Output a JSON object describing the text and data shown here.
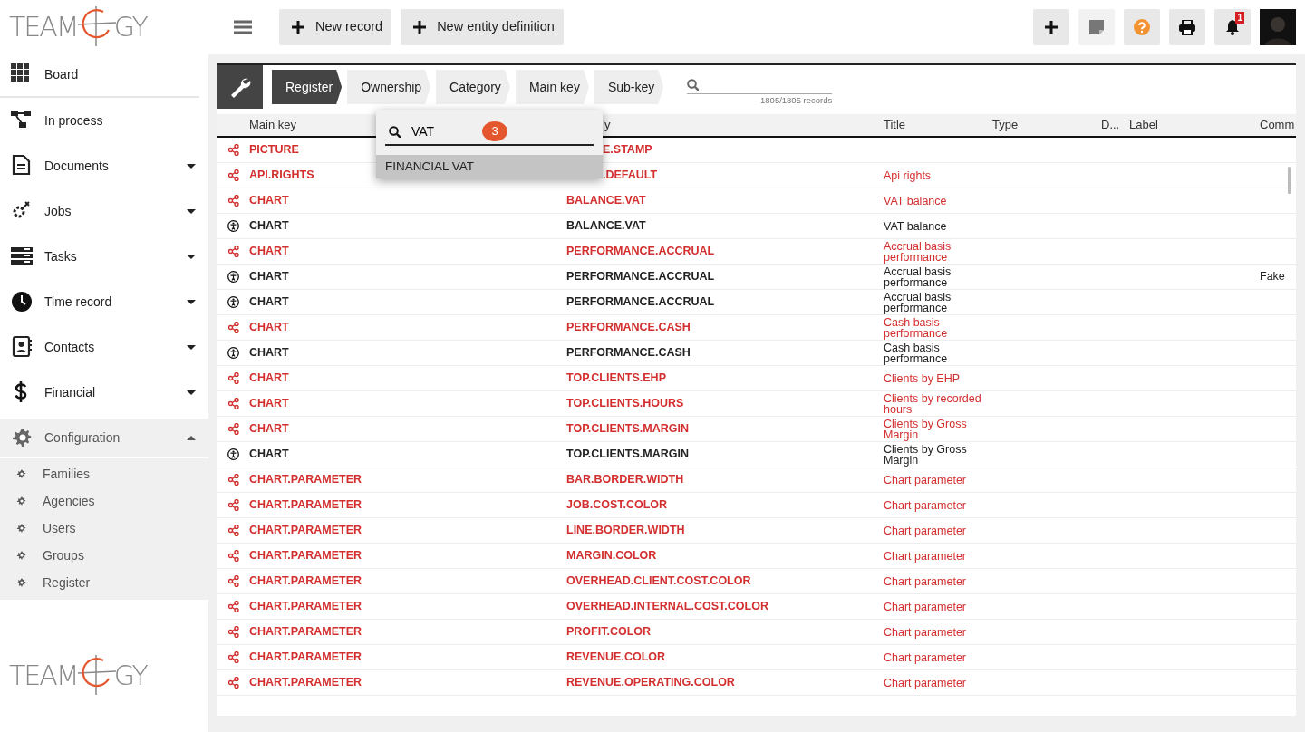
{
  "logo": {
    "left": "TEAM",
    "right": "GY"
  },
  "sidebar": {
    "items": [
      {
        "label": "Board"
      },
      {
        "label": "In process"
      },
      {
        "label": "Documents",
        "expanded": false
      },
      {
        "label": "Jobs",
        "expanded": false
      },
      {
        "label": "Tasks",
        "expanded": false
      },
      {
        "label": "Time record",
        "expanded": false
      },
      {
        "label": "Contacts",
        "expanded": false
      },
      {
        "label": "Financial",
        "expanded": false
      },
      {
        "label": "Configuration",
        "expanded": true,
        "children": [
          {
            "label": "Families"
          },
          {
            "label": "Agencies"
          },
          {
            "label": "Users"
          },
          {
            "label": "Groups"
          },
          {
            "label": "Register"
          }
        ]
      }
    ]
  },
  "footer_logo": {
    "left": "TEAM",
    "right": "GY"
  },
  "toolbar": {
    "buttons": [
      "New record",
      "New entity definition"
    ],
    "notification_count": "1"
  },
  "breadcrumb": [
    {
      "label": "Register",
      "selected": true
    },
    {
      "label": "Ownership",
      "selected": false
    },
    {
      "label": "Category",
      "selected": false
    },
    {
      "label": "Main key",
      "selected": false
    },
    {
      "label": "Sub-key",
      "selected": false
    }
  ],
  "search": {
    "records": "1805/1805 records"
  },
  "filter_popup": {
    "value": "VAT",
    "count": "3",
    "options": [
      {
        "label": "FINANCIAL VAT",
        "selected": true
      }
    ]
  },
  "table": {
    "columns": [
      "Main key",
      "y",
      "Title",
      "Type",
      "D...",
      "Label",
      "Comm"
    ],
    "rows": [
      {
        "kind": "shared",
        "main_key": "PICTURE",
        "sub_key": "E.STAMP",
        "sub_key_covered": true
      },
      {
        "kind": "shared",
        "main_key": "API.RIGHTS",
        "sub_key": ".DEFAULT",
        "sub_key_covered": true,
        "title": "Api rights"
      },
      {
        "kind": "shared",
        "main_key": "CHART",
        "sub_key": "BALANCE.VAT",
        "title": "VAT balance"
      },
      {
        "kind": "public",
        "main_key": "CHART",
        "sub_key": "BALANCE.VAT",
        "title": "VAT balance"
      },
      {
        "kind": "shared",
        "main_key": "CHART",
        "sub_key": "PERFORMANCE.ACCRUAL",
        "title": "Accrual basis performance"
      },
      {
        "kind": "public",
        "main_key": "CHART",
        "sub_key": "PERFORMANCE.ACCRUAL",
        "title": "Accrual basis performance",
        "comment": "Fake"
      },
      {
        "kind": "public",
        "main_key": "CHART",
        "sub_key": "PERFORMANCE.ACCRUAL",
        "title": "Accrual basis performance"
      },
      {
        "kind": "shared",
        "main_key": "CHART",
        "sub_key": "PERFORMANCE.CASH",
        "title": "Cash basis performance"
      },
      {
        "kind": "public",
        "main_key": "CHART",
        "sub_key": "PERFORMANCE.CASH",
        "title": "Cash basis performance"
      },
      {
        "kind": "shared",
        "main_key": "CHART",
        "sub_key": "TOP.CLIENTS.EHP",
        "title": "Clients by EHP"
      },
      {
        "kind": "shared",
        "main_key": "CHART",
        "sub_key": "TOP.CLIENTS.HOURS",
        "title": "Clients by recorded hours"
      },
      {
        "kind": "shared",
        "main_key": "CHART",
        "sub_key": "TOP.CLIENTS.MARGIN",
        "title": "Clients by Gross Margin"
      },
      {
        "kind": "public",
        "main_key": "CHART",
        "sub_key": "TOP.CLIENTS.MARGIN",
        "title": "Clients by Gross Margin"
      },
      {
        "kind": "shared",
        "main_key": "CHART.PARAMETER",
        "sub_key": "BAR.BORDER.WIDTH",
        "title": "Chart parameter"
      },
      {
        "kind": "shared",
        "main_key": "CHART.PARAMETER",
        "sub_key": "JOB.COST.COLOR",
        "title": "Chart parameter"
      },
      {
        "kind": "shared",
        "main_key": "CHART.PARAMETER",
        "sub_key": "LINE.BORDER.WIDTH",
        "title": "Chart parameter"
      },
      {
        "kind": "shared",
        "main_key": "CHART.PARAMETER",
        "sub_key": "MARGIN.COLOR",
        "title": "Chart parameter"
      },
      {
        "kind": "shared",
        "main_key": "CHART.PARAMETER",
        "sub_key": "OVERHEAD.CLIENT.COST.COLOR",
        "title": "Chart parameter"
      },
      {
        "kind": "shared",
        "main_key": "CHART.PARAMETER",
        "sub_key": "OVERHEAD.INTERNAL.COST.COLOR",
        "title": "Chart parameter"
      },
      {
        "kind": "shared",
        "main_key": "CHART.PARAMETER",
        "sub_key": "PROFIT.COLOR",
        "title": "Chart parameter"
      },
      {
        "kind": "shared",
        "main_key": "CHART.PARAMETER",
        "sub_key": "REVENUE.COLOR",
        "title": "Chart parameter"
      },
      {
        "kind": "shared",
        "main_key": "CHART.PARAMETER",
        "sub_key": "REVENUE.OPERATING.COLOR",
        "title": "Chart parameter"
      }
    ]
  }
}
